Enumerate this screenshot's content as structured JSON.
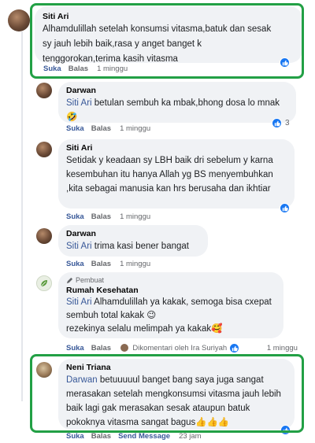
{
  "comments": [
    {
      "author": "Siti Ari",
      "text": "Alhamdulillah setelah konsumsi vitasma,batuk dan sesak sy jauh lebih baik,rasa y anget banget k tenggorokan,terima kasih vitasma",
      "actions": [
        "Suka",
        "Balas"
      ],
      "time": "1 minggu",
      "reaction_icon": "like-icon"
    },
    {
      "author": "Darwan",
      "mention": "Siti Ari",
      "text": " betulan sembuh ka mbak,bhong dosa lo mnak🤣",
      "actions": [
        "Suka",
        "Balas"
      ],
      "time": "1 minggu",
      "reaction_count": "3",
      "reaction_icon": "like-icon"
    },
    {
      "author": "Siti Ari",
      "text": "Setidak y keadaan sy LBH baik dri sebelum y karna kesembuhan itu hanya Allah yg BS menyembuhkan ,kita sebagai manusia kan hrs berusaha dan ikhtiar",
      "actions": [
        "Suka",
        "Balas"
      ],
      "time": "1 minggu",
      "reaction_icon": "like-icon"
    },
    {
      "author": "Darwan",
      "mention": "Siti Ari",
      "text": " trima kasi bener bangat",
      "actions": [
        "Suka",
        "Balas"
      ],
      "time": "1 minggu"
    },
    {
      "author_badge": "Pembuat",
      "author": "Rumah Kesehatan",
      "mention": "Siti Ari",
      "text": " Alhamdulillah ya kakak, semoga bisa cxepat sembuh total kakak 😉",
      "text2": "rezekinya selalu melimpah ya kakak🥰",
      "actions": [
        "Suka",
        "Balas"
      ],
      "commented_by": "Dikomentari oleh Ira Suriyah",
      "time": "1 minggu",
      "reaction_icon": "like-icon"
    },
    {
      "author": "Neni Triana",
      "mention": "Darwan",
      "text": " betuuuuul banget bang saya juga sangat merasakan setelah mengkonsumsi vitasma jauh lebih baik lagi gak merasakan sesak ataupun batuk pokoknya vitasma sangat bagus👍👍👍",
      "actions": [
        "Suka",
        "Balas",
        "Send Message"
      ],
      "time": "23 jam",
      "reaction_icon": "like-icon"
    }
  ],
  "colors": {
    "highlight": "#22a045",
    "mention": "#385898",
    "bubble": "#f0f2f5",
    "like": "#1877f2"
  }
}
